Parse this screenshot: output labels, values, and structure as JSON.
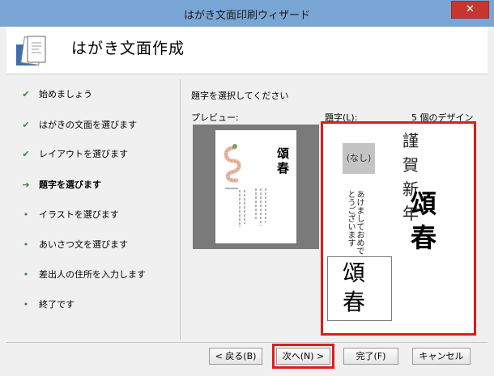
{
  "window": {
    "title": "はがき文面印刷ウィザード",
    "close_label": "✕"
  },
  "header": {
    "title": "はがき文面作成",
    "icon": "postcard-wizard-icon"
  },
  "nav": {
    "items": [
      {
        "label": "始めましょう",
        "state": "done",
        "mark": "✔"
      },
      {
        "label": "はがきの文面を選びます",
        "state": "done",
        "mark": "✔"
      },
      {
        "label": "レイアウトを選びます",
        "state": "done",
        "mark": "✔"
      },
      {
        "label": "題字を選びます",
        "state": "current",
        "mark": "➔"
      },
      {
        "label": "イラストを選びます",
        "state": "pending",
        "mark": "•"
      },
      {
        "label": "あいさつ文を選びます",
        "state": "pending",
        "mark": "•"
      },
      {
        "label": "差出人の住所を入力します",
        "state": "pending",
        "mark": "•"
      },
      {
        "label": "終了です",
        "state": "pending",
        "mark": "•"
      }
    ]
  },
  "main": {
    "instruction": "題字を選択してください",
    "preview_label": "プレビュー:",
    "daiji_label": "題字(L):",
    "design_count": "5 個のデザイン",
    "gallery": {
      "none_label": "(なし)",
      "designs": [
        {
          "text": "謹賀新年"
        },
        {
          "text": "頌春"
        },
        {
          "text": "あけましておめでとうございます"
        },
        {
          "text": "頌春"
        }
      ]
    },
    "postcard_title": "頌春"
  },
  "buttons": {
    "back": "< 戻る(B)",
    "next": "次へ(N) >",
    "finish": "完了(F)",
    "cancel": "キャンセル"
  },
  "colors": {
    "titlebar": "#7aa6d6",
    "close": "#c7372f",
    "highlight": "#e01b1b",
    "check": "#2d8a3a"
  }
}
